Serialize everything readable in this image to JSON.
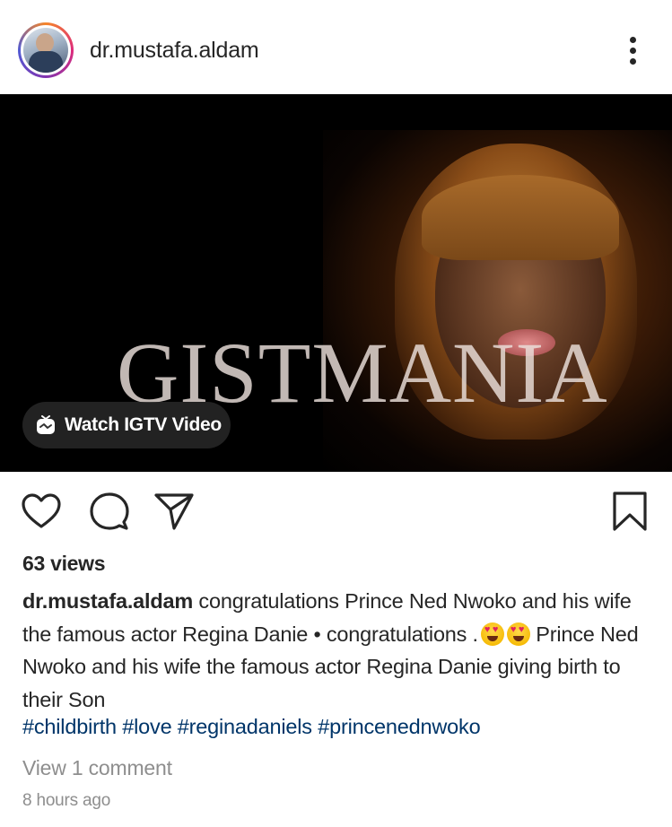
{
  "post": {
    "username": "dr.mustafa.aldam",
    "media": {
      "watermark": "GISTMANIA",
      "igtv_label": "Watch IGTV Video"
    },
    "views": "63 views",
    "caption": {
      "username": "dr.mustafa.aldam",
      "text_part1": " congratulations Prince Ned Nwoko and his wife the famous actor Regina Danie • congratulations .",
      "text_part2": " Prince Ned Nwoko and his wife the famous actor Regina Danie giving birth to their Son",
      "emojis": [
        "heart-eyes-emoji",
        "heart-eyes-emoji"
      ]
    },
    "hashtags": [
      "#childbirth",
      "#love",
      "#reginadaniels",
      "#princenednwoko"
    ],
    "view_comments": "View 1 comment",
    "time_ago": "8 hours ago"
  },
  "icons": {
    "more": "more-vertical-icon",
    "like": "heart-icon",
    "comment": "comment-icon",
    "share": "send-icon",
    "save": "bookmark-icon",
    "igtv": "igtv-icon"
  },
  "colors": {
    "text": "#262626",
    "hashtag": "#003569",
    "muted": "#8e8e8e",
    "media_bg": "#000000"
  }
}
